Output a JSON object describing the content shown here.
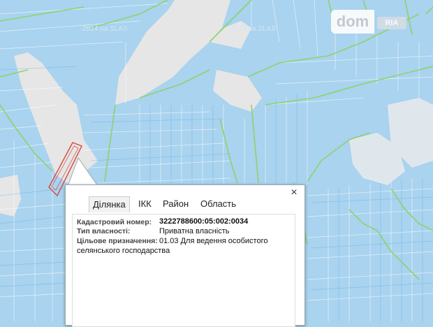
{
  "watermark": "2014 ua.SLAS",
  "logo": {
    "brand": "dom",
    "sub": "RIA"
  },
  "popup": {
    "close_label": "×",
    "tabs": [
      {
        "label": "Ділянка",
        "active": true
      },
      {
        "label": "ІКК",
        "active": false
      },
      {
        "label": "Район",
        "active": false
      },
      {
        "label": "Область",
        "active": false
      }
    ],
    "fields": [
      {
        "label": "Кадастровий номер:",
        "value": "3222788600:05:002:0034"
      },
      {
        "label": "Тип власності:",
        "value": "Приватна власність"
      },
      {
        "label": "Цільове призначення:",
        "value": "01.03 Для ведення особистого"
      },
      {
        "label": "",
        "value": "селянського господарства"
      }
    ]
  },
  "colors": {
    "water": "#a8d4ee",
    "parcel_line": "#6fb7e8",
    "boundary": "#8fd26a",
    "land": "#e7e7e7",
    "highlight": "#d9453b"
  }
}
